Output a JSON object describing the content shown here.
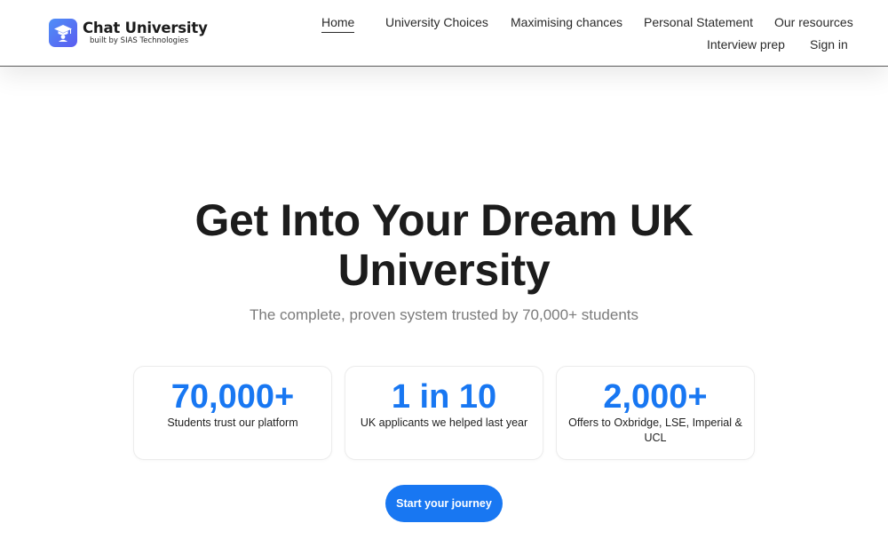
{
  "brand": {
    "name": "Chat University",
    "tagline": "built by SIAS Technologies",
    "icon": "graduation-cap-icon",
    "accent": "#1877f2"
  },
  "nav": {
    "items": [
      {
        "label": "Home",
        "active": true
      },
      {
        "label": "University Choices"
      },
      {
        "label": "Maximising chances"
      },
      {
        "label": "Personal Statement"
      },
      {
        "label": "Our resources"
      },
      {
        "label": "Interview prep"
      },
      {
        "label": "Sign in"
      }
    ]
  },
  "hero": {
    "title_lines": [
      "Get Into Your Dream UK",
      "University"
    ],
    "subtitle": "The complete, proven system trusted by 70,000+ students"
  },
  "stats": [
    {
      "value": "70,000+",
      "label": "Students trust our platform"
    },
    {
      "value": "1 in 10",
      "label": "UK applicants we helped last year"
    },
    {
      "value": "2,000+",
      "label": "Offers to Oxbridge, LSE, Imperial & UCL"
    }
  ],
  "cta": {
    "label": "Start your journey"
  }
}
